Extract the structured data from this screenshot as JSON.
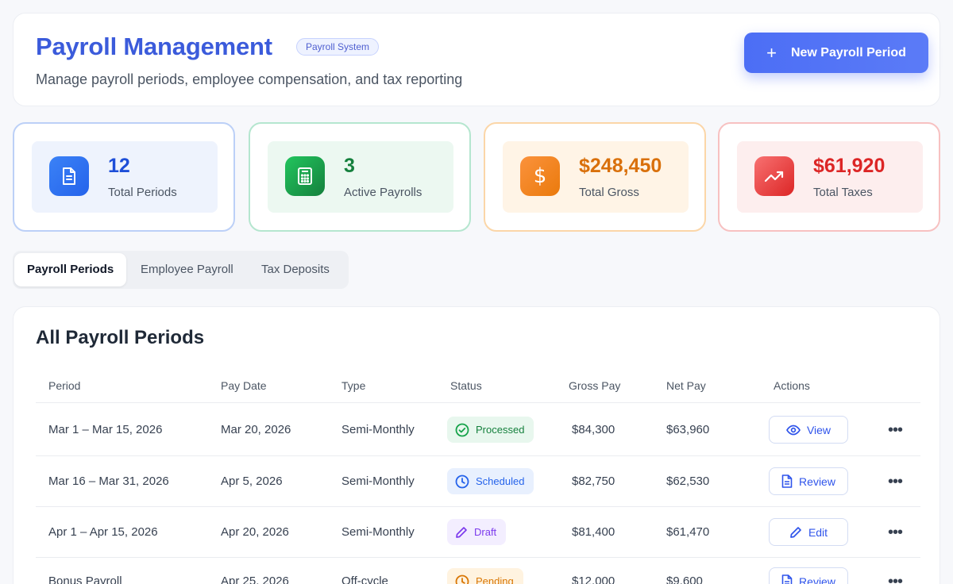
{
  "header": {
    "title": "Payroll Management",
    "badge": "Payroll System",
    "subtitle": "Manage payroll periods, employee compensation, and tax reporting",
    "new_button_label": "New Payroll Period"
  },
  "stats": [
    {
      "value": "12",
      "label": "Total Periods",
      "icon": "document-icon",
      "color": "#2563eb"
    },
    {
      "value": "3",
      "label": "Active Payrolls",
      "icon": "calculator-icon",
      "color": "#16a34a"
    },
    {
      "value": "$248,450",
      "label": "Total Gross",
      "icon": "dollar-icon",
      "color": "#ea7a0c"
    },
    {
      "value": "$61,920",
      "label": "Total Taxes",
      "icon": "trending-up-icon",
      "color": "#dc2626"
    }
  ],
  "tabs": [
    {
      "label": "Payroll Periods",
      "active": true
    },
    {
      "label": "Employee Payroll",
      "active": false
    },
    {
      "label": "Tax Deposits",
      "active": false
    }
  ],
  "table": {
    "title": "All Payroll Periods",
    "columns": [
      "Period",
      "Pay Date",
      "Type",
      "Status",
      "Gross Pay",
      "Net Pay",
      "Actions"
    ],
    "rows": [
      {
        "period": "Mar 1 – Mar 15, 2026",
        "pay_date": "Mar 20, 2026",
        "type": "Semi-Monthly",
        "status": "Processed",
        "gross": "$84,300",
        "net": "$63,960",
        "action": "View"
      },
      {
        "period": "Mar 16 – Mar 31, 2026",
        "pay_date": "Apr 5, 2026",
        "type": "Semi-Monthly",
        "status": "Scheduled",
        "gross": "$82,750",
        "net": "$62,530",
        "action": "Review"
      },
      {
        "period": "Apr 1 – Apr 15, 2026",
        "pay_date": "Apr 20, 2026",
        "type": "Semi-Monthly",
        "status": "Draft",
        "gross": "$81,400",
        "net": "$61,470",
        "action": "Edit"
      },
      {
        "period": "Bonus Payroll",
        "pay_date": "Apr 25, 2026",
        "type": "Off-cycle",
        "status": "Pending",
        "gross": "$12,000",
        "net": "$9,600",
        "action": "Review"
      }
    ]
  },
  "colors": {
    "accent": "#4c6ef5",
    "processed": "#15803d",
    "scheduled": "#2563eb",
    "draft": "#7c3aed",
    "pending": "#d97706"
  }
}
